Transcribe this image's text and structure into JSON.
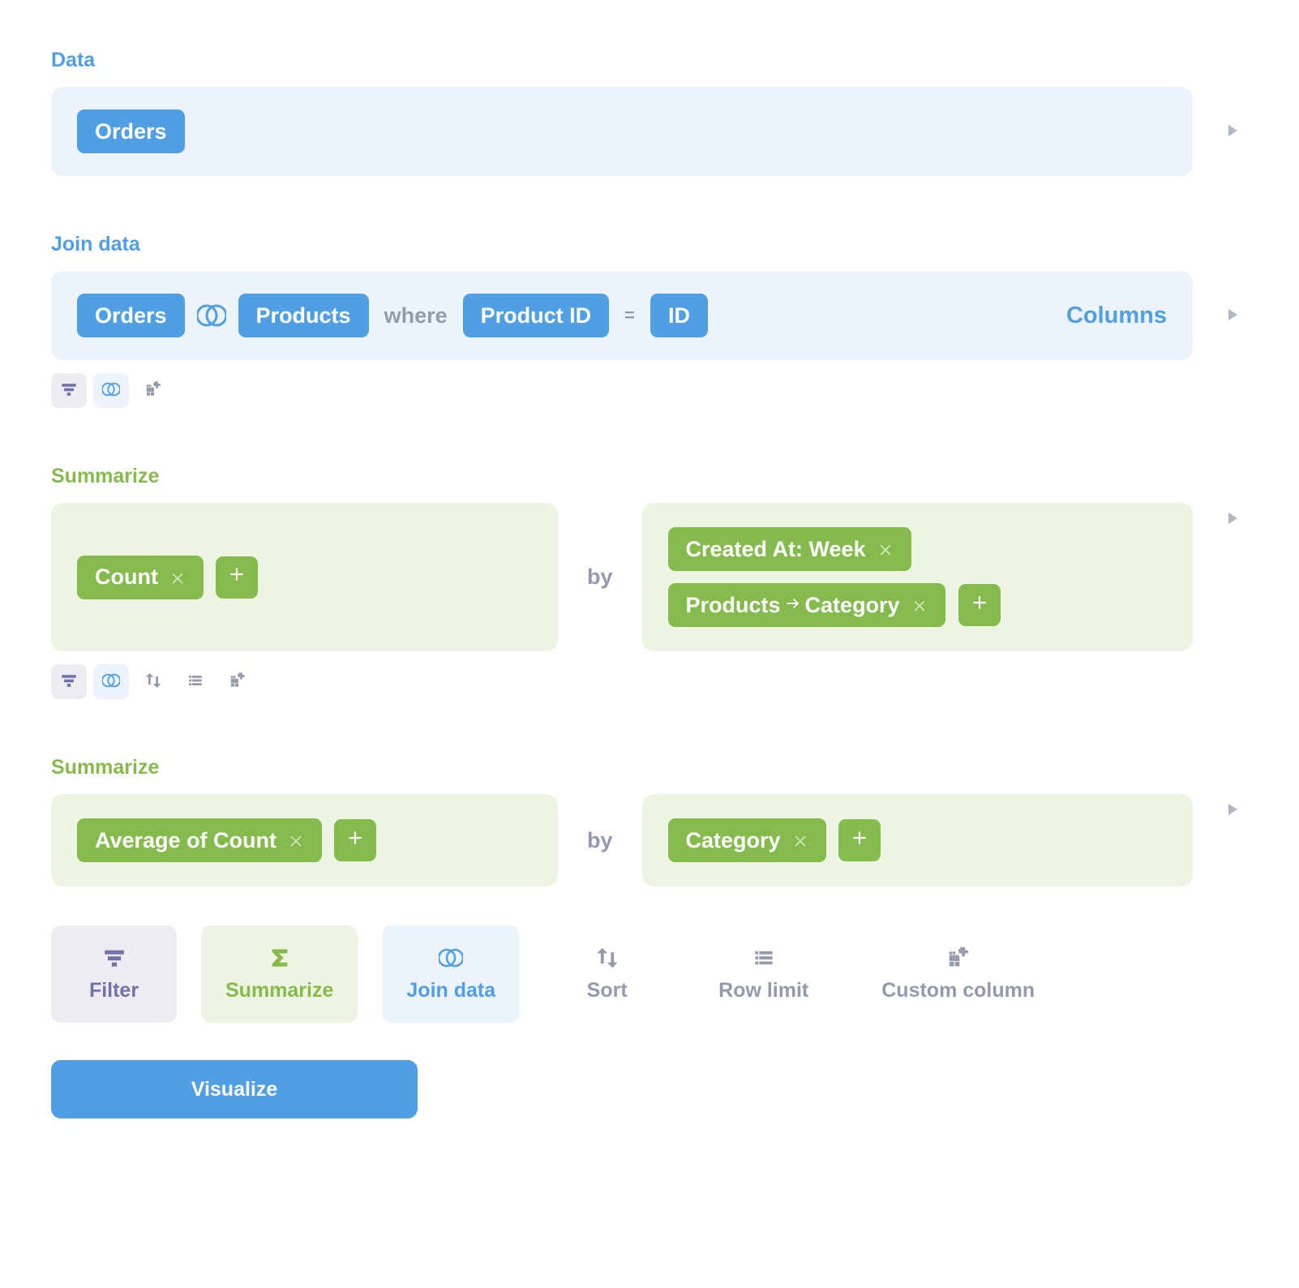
{
  "colors": {
    "blue": "#509ee3",
    "green": "#84bb4c",
    "purple": "#7172ad"
  },
  "sections": {
    "data": {
      "label": "Data",
      "table": "Orders"
    },
    "join": {
      "label": "Join data",
      "left_table": "Orders",
      "right_table": "Products",
      "where_keyword": "where",
      "condition_left": "Product ID",
      "equals": "=",
      "condition_right": "ID",
      "columns_label": "Columns",
      "toolbar": {
        "filter": "filter-icon",
        "join": "join-icon",
        "custom": "custom-column-icon"
      }
    },
    "summarize1": {
      "label": "Summarize",
      "aggs": [
        "Count"
      ],
      "by_keyword": "by",
      "groupings": [
        "Created At: Week",
        "Products → Category"
      ],
      "toolbar": {
        "filter": "filter-icon",
        "join": "join-icon",
        "sort": "sort-icon",
        "rowlimit": "list-icon",
        "custom": "custom-column-icon"
      }
    },
    "summarize2": {
      "label": "Summarize",
      "aggs": [
        "Average of Count"
      ],
      "by_keyword": "by",
      "groupings": [
        "Category"
      ]
    }
  },
  "step_toolbar": [
    {
      "id": "filter",
      "label": "Filter",
      "variant": "purple",
      "icon": "filter"
    },
    {
      "id": "summarize",
      "label": "Summarize",
      "variant": "green",
      "icon": "sigma"
    },
    {
      "id": "join",
      "label": "Join data",
      "variant": "blue",
      "icon": "join"
    },
    {
      "id": "sort",
      "label": "Sort",
      "variant": "muted",
      "icon": "sort"
    },
    {
      "id": "rowlimit",
      "label": "Row limit",
      "variant": "muted",
      "icon": "list"
    },
    {
      "id": "custom",
      "label": "Custom column",
      "variant": "muted",
      "icon": "grid-plus"
    }
  ],
  "visualize_button": "Visualize"
}
